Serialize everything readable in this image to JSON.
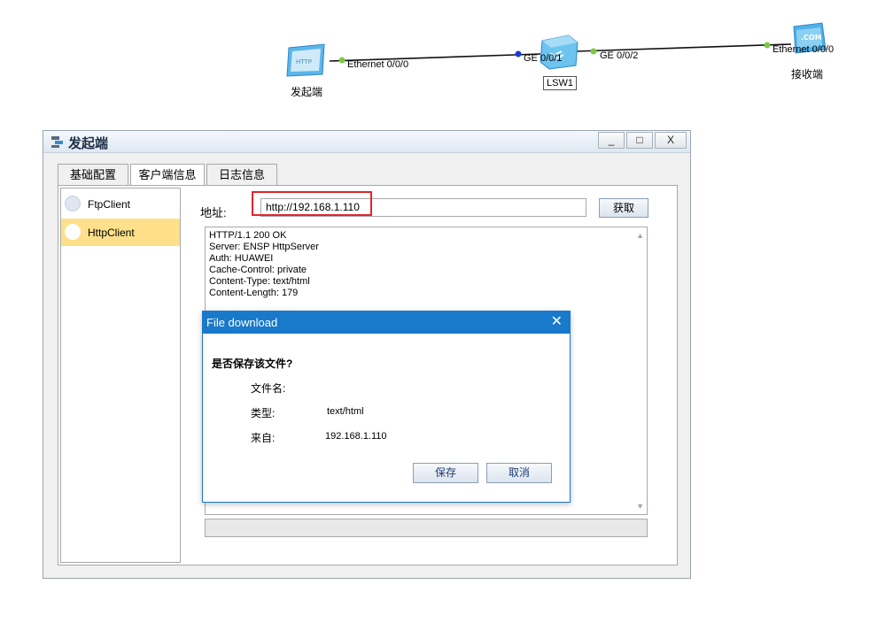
{
  "topology": {
    "devices": [
      {
        "name": "发起端",
        "icon": "http-client-icon",
        "port": "Ethernet 0/0/0"
      },
      {
        "name": "LSW1",
        "icon": "switch-icon",
        "ports": [
          "GE 0/0/1",
          "GE 0/0/2"
        ]
      },
      {
        "name": "接收端",
        "icon": "server-icon",
        "port": "Ethernet 0/0/0",
        "icon_text": ".COM"
      }
    ],
    "http_icon_text": "HTTP"
  },
  "window": {
    "title": "发起端",
    "minimize": "_",
    "maximize": "□",
    "close": "X"
  },
  "tabs": [
    {
      "label": "基础配置",
      "active": false
    },
    {
      "label": "客户端信息",
      "active": true
    },
    {
      "label": "日志信息",
      "active": false
    }
  ],
  "clients": [
    {
      "label": "FtpClient",
      "selected": false
    },
    {
      "label": "HttpClient",
      "selected": true
    }
  ],
  "http_client": {
    "address_label": "地址:",
    "address_value": "http://192.168.1.110",
    "fetch_button": "获取",
    "response_lines": [
      "HTTP/1.1 200 OK",
      "Server: ENSP HttpServer",
      "Auth: HUAWEI",
      "Cache-Control: private",
      "Content-Type: text/html",
      "Content-Length: 179"
    ]
  },
  "dialog": {
    "title": "File download",
    "close": "✕",
    "question": "是否保存该文件?",
    "filename_label": "文件名:",
    "filename_value": "",
    "type_label": "类型:",
    "type_value": "text/html",
    "from_label": "来自:",
    "from_value": "192.168.1.110",
    "save_button": "保存",
    "cancel_button": "取消"
  },
  "colors": {
    "accent_blue": "#1979ca",
    "selected_item": "#fde089",
    "highlight_red": "#e0262c",
    "link_green": "#7ac943",
    "link_blue": "#1a3bd6"
  }
}
